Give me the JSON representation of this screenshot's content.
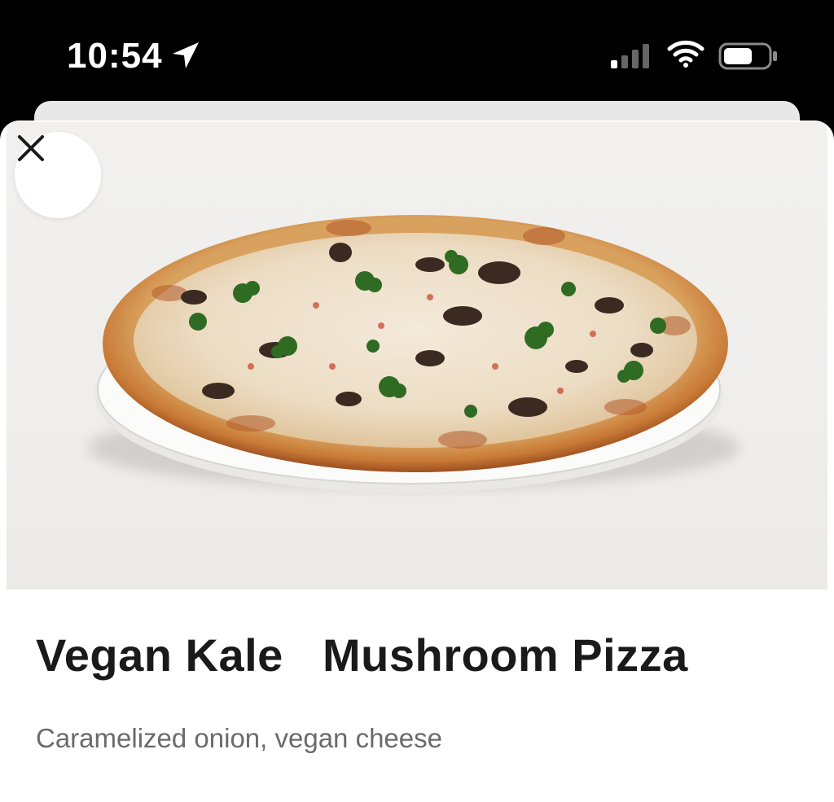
{
  "status_bar": {
    "time": "10:54",
    "icons": [
      "location-arrow-icon",
      "cellular-signal-icon",
      "wifi-icon",
      "battery-icon"
    ]
  },
  "item": {
    "image_alt": "Vegan Kale Mushroom Pizza",
    "title": "Vegan Kale   Mushroom Pizza",
    "description": "Caramelized onion, vegan cheese"
  },
  "controls": {
    "close_icon": "close-icon"
  },
  "colors": {
    "status_bar_bg": "#000000",
    "sheet_bg": "#ffffff",
    "title_text": "#1a1a1a",
    "subtitle_text": "#6b6b6b"
  }
}
